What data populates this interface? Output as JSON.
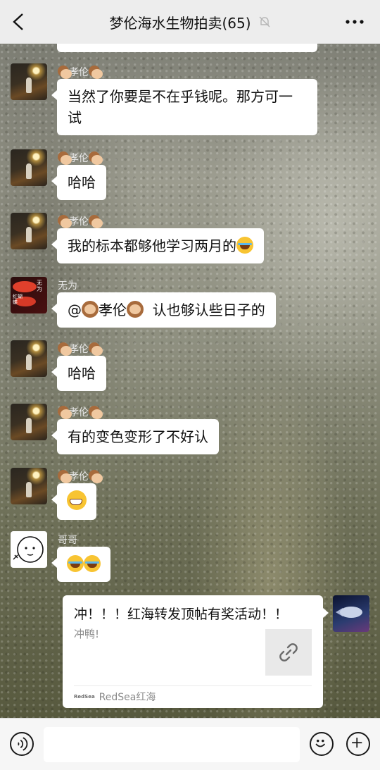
{
  "header": {
    "back_icon": "chevron-left-icon",
    "title": "梦伦海水生物拍卖(65)",
    "mute_icon": "bell-off-icon",
    "more_icon": "ellipsis-icon"
  },
  "messages": [
    {
      "sender": "孝伦",
      "text": "当然了你要是不在乎钱呢。那方可一试",
      "line1": "当然了你要是不在乎钱呢。那方可一",
      "line2": "试"
    },
    {
      "sender": "孝伦",
      "text": "哈哈"
    },
    {
      "sender": "孝伦",
      "text": "我的标本都够他学习两月的",
      "emoji": "laughing-tears-emoji"
    },
    {
      "sender": "无为",
      "text": "@孝伦 认也够认些日子的",
      "mention_prefix": "@",
      "mention_name": "孝伦",
      "rest": "认也够认些日子的",
      "avatar_text_1": "无为",
      "avatar_text_2": "红蝴蝶"
    },
    {
      "sender": "孝伦",
      "text": "哈哈"
    },
    {
      "sender": "孝伦",
      "text": "有的变色变形了不好认"
    },
    {
      "sender": "孝伦",
      "emoji": "grinning-emoji"
    },
    {
      "sender": "哥哥",
      "emoji": "laughing-tears-emoji x2"
    }
  ],
  "link_card": {
    "title": "冲！！！红海转发顶帖有奖活动！！",
    "description": "冲鸭!",
    "source_logo": "RedSea",
    "source": "RedSea红海",
    "thumb_icon": "link-icon"
  },
  "input_bar": {
    "voice_icon": "voice-icon",
    "emoji_icon": "emoji-icon",
    "plus_icon": "plus-icon"
  }
}
